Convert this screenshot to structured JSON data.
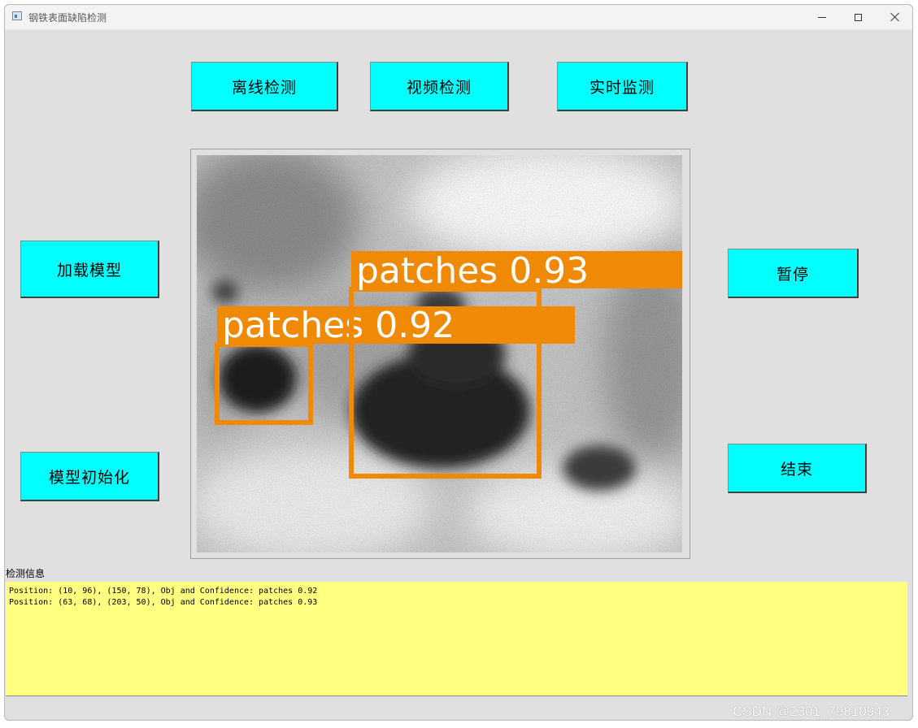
{
  "window": {
    "title": "钢铁表面缺陷检测"
  },
  "buttons": {
    "offline_detect": "离线检测",
    "video_detect": "视频检测",
    "realtime_monitor": "实时监测",
    "load_model": "加载模型",
    "model_init": "模型初始化",
    "pause": "暂停",
    "end": "结束"
  },
  "detections": [
    {
      "label": "patches 0.92"
    },
    {
      "label": "patches 0.93"
    }
  ],
  "info": {
    "label": "检测信息",
    "lines": [
      "Position: (10, 96), (150, 78), Obj and Confidence: patches 0.92",
      "Position: (63, 68), (203, 50), Obj and Confidence: patches 0.93"
    ]
  },
  "colors": {
    "button_bg": "#00ffff",
    "info_bg": "#ffff80",
    "box_color": "#f08a06"
  },
  "watermark": "CSDN @2301_79810943"
}
